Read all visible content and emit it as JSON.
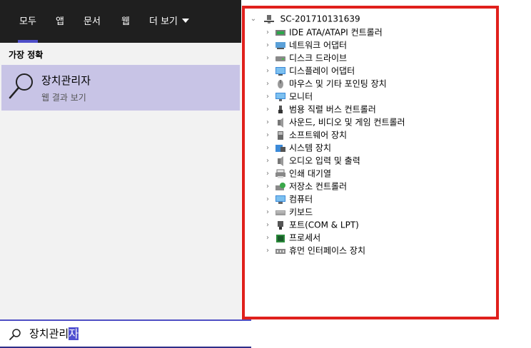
{
  "search": {
    "tabs": [
      {
        "label": "모두"
      },
      {
        "label": "앱"
      },
      {
        "label": "문서"
      },
      {
        "label": "웹"
      },
      {
        "label": "더 보기"
      }
    ],
    "best_match_heading": "가장 정확",
    "best_match": {
      "title": "장치관리자",
      "subtitle": "웹 결과 보기",
      "icon": "magnifier-icon"
    },
    "query_prefix": "장치관리",
    "query_selected": "자"
  },
  "device_manager": {
    "root": "SC-201710131639",
    "categories": [
      {
        "label": "IDE ATA/ATAPI 컨트롤러",
        "icon": "ide-controller-icon"
      },
      {
        "label": "네트워크 어댑터",
        "icon": "network-adapter-icon"
      },
      {
        "label": "디스크 드라이브",
        "icon": "disk-drive-icon"
      },
      {
        "label": "디스플레이 어댑터",
        "icon": "display-adapter-icon"
      },
      {
        "label": "마우스 및 기타 포인팅 장치",
        "icon": "mouse-icon"
      },
      {
        "label": "모니터",
        "icon": "monitor-icon"
      },
      {
        "label": "범용 직렬 버스 컨트롤러",
        "icon": "usb-icon"
      },
      {
        "label": "사운드, 비디오 및 게임 컨트롤러",
        "icon": "speaker-icon"
      },
      {
        "label": "소프트웨어 장치",
        "icon": "software-device-icon"
      },
      {
        "label": "시스템 장치",
        "icon": "system-device-icon"
      },
      {
        "label": "오디오 입력 및 출력",
        "icon": "audio-icon"
      },
      {
        "label": "인쇄 대기열",
        "icon": "printer-icon"
      },
      {
        "label": "저장소 컨트롤러",
        "icon": "storage-controller-icon"
      },
      {
        "label": "컴퓨터",
        "icon": "computer-icon"
      },
      {
        "label": "키보드",
        "icon": "keyboard-icon"
      },
      {
        "label": "포트(COM & LPT)",
        "icon": "port-icon"
      },
      {
        "label": "프로세서",
        "icon": "processor-icon"
      },
      {
        "label": "휴먼 인터페이스 장치",
        "icon": "hid-icon"
      }
    ]
  },
  "colors": {
    "tab_bar": "#1f1f1f",
    "accent": "#4e4ec8",
    "best_match_bg": "#c8c4e6",
    "highlight_border": "#e0201c"
  }
}
